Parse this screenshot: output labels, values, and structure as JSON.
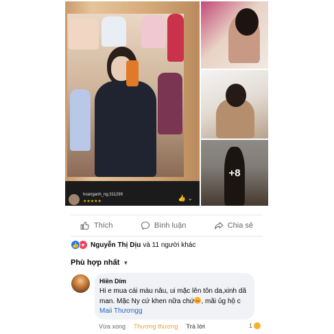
{
  "post": {
    "overlay": {
      "username": "hoanganh_ng.311299",
      "stars": "★★★★★",
      "icons": "👍  ⌄"
    },
    "more_photos_label": "+8"
  },
  "actions": {
    "like_label": "Thích",
    "comment_label": "Bình luận",
    "share_label": "Chia sẻ"
  },
  "reactions": {
    "name": "Nguyễn Thị Dịu",
    "rest": "và 11 người khác"
  },
  "sort": {
    "label": "Phù hợp nhất",
    "chevron": "▼"
  },
  "comment": {
    "author": "Hiền Dím",
    "text_before": "Hi e mua cái màu nâu, ui mặc lên tôn da,xinh dã man. Mặc Ny cứ khen nữa chứ",
    "text_after": ", mãi ủg hộ c ",
    "tag": "Maii Thươngg",
    "time": "Vừa xong",
    "reaction_label": "Thương thương",
    "reply_label": "Trả lời",
    "reaction_count": "1"
  },
  "colors": {
    "like_blue": "#1877f2",
    "love_red": "#f33e58",
    "meta_gray": "#65676b",
    "bubble_bg": "#f0f2f5",
    "care_orange": "#e8a040"
  }
}
